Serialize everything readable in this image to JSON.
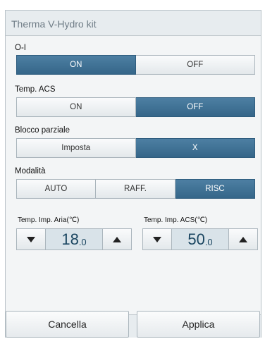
{
  "dialog": {
    "title": "Therma V-Hydro kit"
  },
  "power": {
    "label": "O-I",
    "options": [
      "ON",
      "OFF"
    ],
    "selected": "ON"
  },
  "dhw": {
    "label": "Temp. ACS",
    "options": [
      "ON",
      "OFF"
    ],
    "selected": "OFF"
  },
  "lock": {
    "label": "Blocco parziale",
    "options": [
      "Imposta",
      "X"
    ],
    "selected": "X"
  },
  "mode": {
    "label": "Modalità",
    "options": [
      "AUTO",
      "RAFF.",
      "RISC"
    ],
    "selected": "RISC"
  },
  "air_temp": {
    "label": "Temp. Imp. Aria(℃)",
    "value_int": "18",
    "value_dec": ".0"
  },
  "dhw_temp": {
    "label": "Temp. Imp. ACS(℃)",
    "value_int": "50",
    "value_dec": ".0"
  },
  "footer": {
    "cancel_label": "Cancella",
    "apply_label": "Applica"
  },
  "colors": {
    "selected": "#3f7196",
    "value_bg": "#d9e3e9"
  },
  "icons": {
    "decrease": "triangle-down-icon",
    "increase": "triangle-up-icon"
  }
}
